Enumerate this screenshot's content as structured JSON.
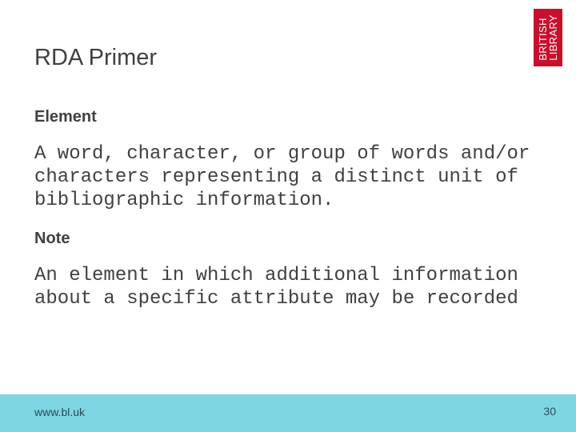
{
  "logo": {
    "line1": "BRITISH",
    "line2": "LIBRARY",
    "color": "#c8102e"
  },
  "slide": {
    "title": "RDA Primer",
    "sections": [
      {
        "heading": "Element",
        "text": "A word, character, or group of words and/or\ncharacters representing a distinct unit of\nbibliographic information."
      },
      {
        "heading": "Note",
        "text": "An element in which additional information\nabout a specific attribute may be recorded"
      }
    ]
  },
  "footer": {
    "url": "www.bl.uk",
    "page_number": "30",
    "color": "#7dd6e2"
  }
}
